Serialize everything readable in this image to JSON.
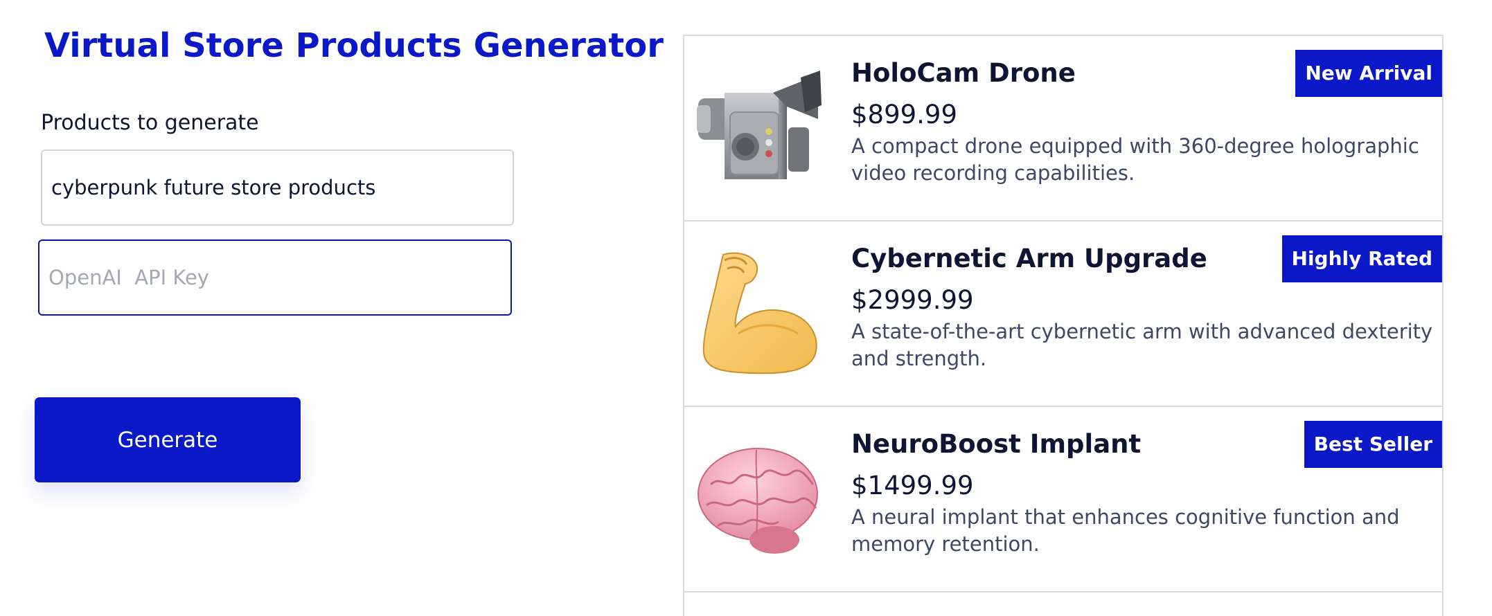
{
  "page": {
    "title": "Virtual Store Products Generator"
  },
  "form": {
    "products_label": "Products to generate",
    "products_value": "cyberpunk future store products",
    "api_key_placeholder": "OpenAI  API Key",
    "api_key_value": "",
    "generate_label": "Generate"
  },
  "products": [
    {
      "name": "HoloCam Drone",
      "price": "$899.99",
      "description": "A compact drone equipped with 360-degree holographic video recording capabilities.",
      "badge": "New Arrival",
      "icon": "video-camera-icon"
    },
    {
      "name": "Cybernetic Arm Upgrade",
      "price": "$2999.99",
      "description": "A state-of-the-art cybernetic arm with advanced dexterity and strength.",
      "badge": "Highly Rated",
      "icon": "flexed-bicep-icon"
    },
    {
      "name": "NeuroBoost Implant",
      "price": "$1499.99",
      "description": "A neural implant that enhances cognitive function and memory retention.",
      "badge": "Best Seller",
      "icon": "brain-icon"
    }
  ],
  "colors": {
    "accent": "#0a18c8",
    "text": "#0f1433",
    "muted_text": "#3e4766",
    "border": "#d9dbe1"
  }
}
